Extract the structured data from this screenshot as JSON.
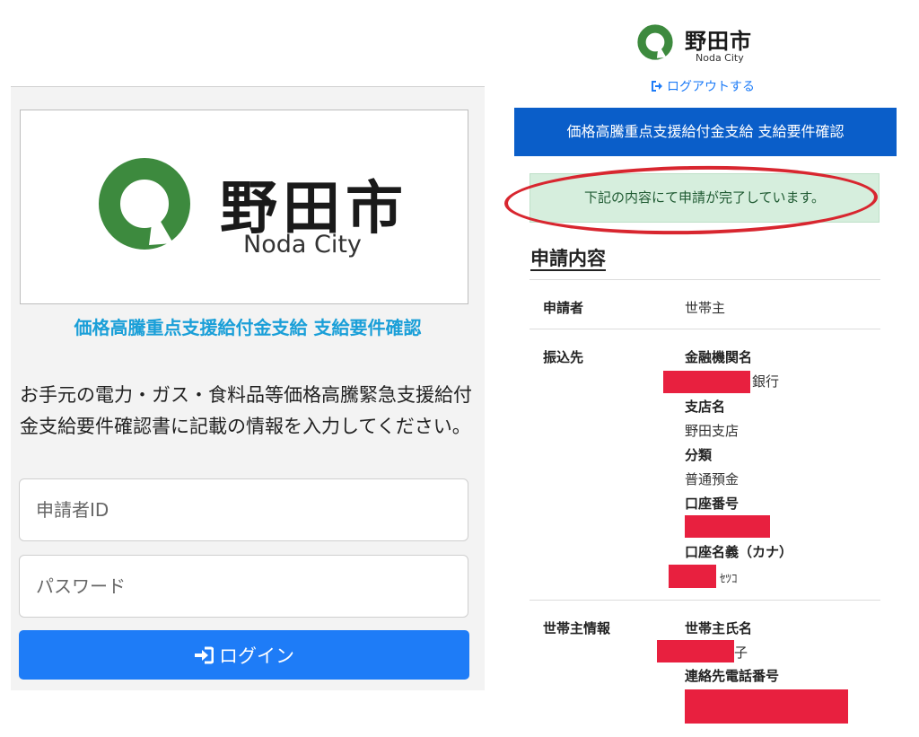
{
  "login": {
    "logo_kanji": "野田市",
    "logo_en": "Noda City",
    "title": "価格高騰重点支援給付金支給 支給要件確認",
    "description": "お手元の電力・ガス・食料品等価格高騰緊急支援給付金支給要件確認書に記載の情報を入力してください。",
    "id_placeholder": "申請者ID",
    "password_placeholder": "パスワード",
    "login_label": "ログイン",
    "login_icon": "sign-in-icon"
  },
  "confirm": {
    "logo_kanji": "野田市",
    "logo_en": "Noda City",
    "logout_label": "ログアウトする",
    "logout_icon": "sign-out-icon",
    "header_title": "価格高騰重点支援給付金支給 支給要件確認",
    "alert_text": "下記の内容にて申請が完了しています。",
    "section_title": "申請内容",
    "applicant_label": "申請者",
    "applicant_value": "世帯主",
    "transfer_label": "振込先",
    "bank_name_label": "金融機関名",
    "bank_name_value_suffix": "銀行",
    "branch_label": "支店名",
    "branch_value": "野田支店",
    "category_label": "分類",
    "category_value": "普通預金",
    "account_no_label": "口座番号",
    "account_name_label": "口座名義（カナ）",
    "account_name_value_suffix": "ｾﾂｺ",
    "household_label": "世帯主情報",
    "household_name_label": "世帯主氏名",
    "household_name_value_suffix": "子",
    "phone_label": "連絡先電話番号"
  },
  "colors": {
    "brand_green": "#3d8a3e",
    "primary_blue": "#1e7cf7",
    "header_blue": "#0a5ec9",
    "title_cyan": "#1a9fd8",
    "alert_bg": "#d6eedd",
    "annotation_red": "#d8262f",
    "redaction_red": "#e8203f"
  }
}
